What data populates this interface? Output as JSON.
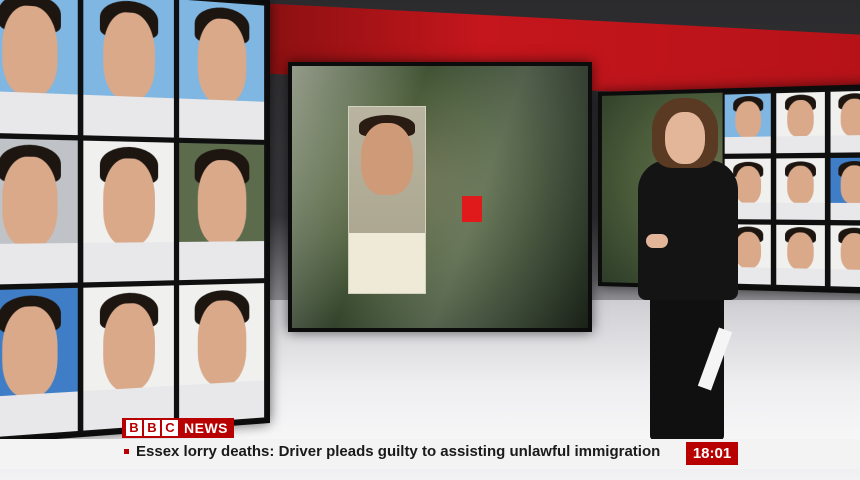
{
  "broadcaster": {
    "logo_letters": [
      "B",
      "B",
      "C"
    ],
    "logo_word": "NEWS"
  },
  "ticker": {
    "headline": "Essex lorry deaths: Driver pleads guilty to assisting unlawful immigration",
    "time": "18:01"
  },
  "colors": {
    "brand_red": "#b80000",
    "studio_red": "#c4161c",
    "ticker_bg": "#f3f3f3"
  }
}
